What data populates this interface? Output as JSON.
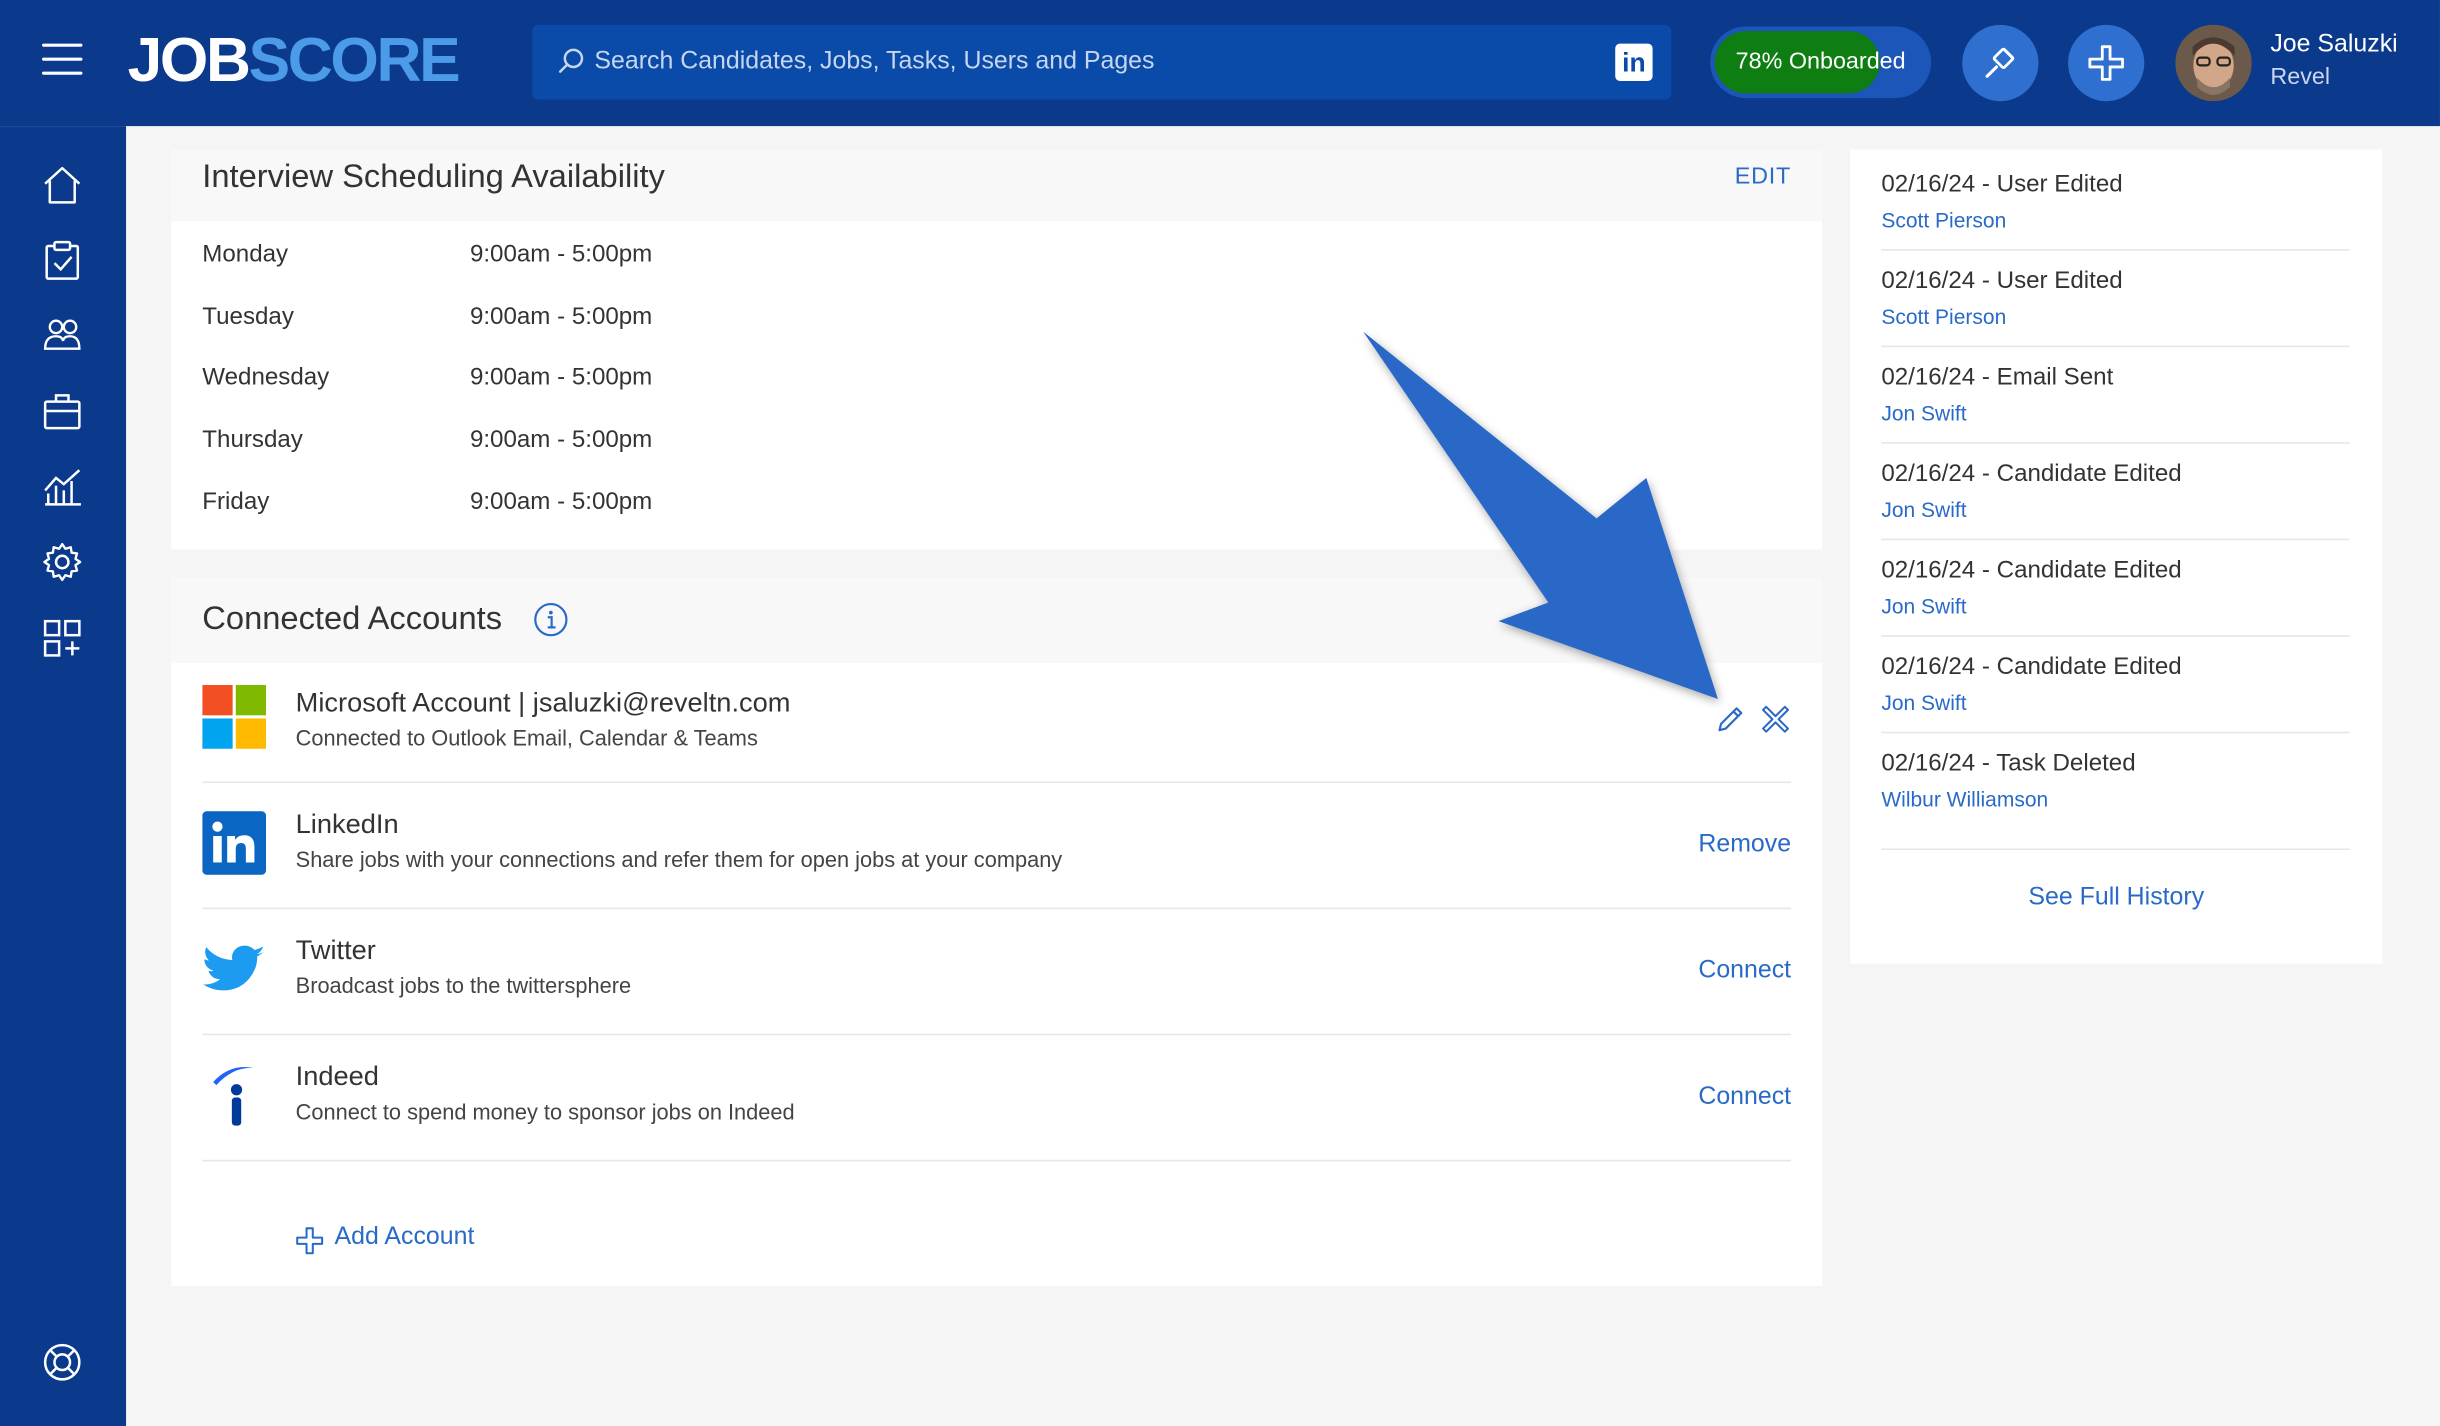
{
  "brand": {
    "logo_part1": "JOB",
    "logo_part2": "SCORE"
  },
  "search": {
    "placeholder": "Search Candidates, Jobs, Tasks, Users and Pages"
  },
  "onboarding": {
    "label": "78% Onboarded",
    "progress_percent": 78
  },
  "user": {
    "name": "Joe Saluzki",
    "org": "Revel"
  },
  "interview": {
    "title": "Interview Scheduling Availability",
    "edit_label": "EDIT",
    "rows": [
      {
        "day": "Monday",
        "time": "9:00am - 5:00pm"
      },
      {
        "day": "Tuesday",
        "time": "9:00am - 5:00pm"
      },
      {
        "day": "Wednesday",
        "time": "9:00am - 5:00pm"
      },
      {
        "day": "Thursday",
        "time": "9:00am - 5:00pm"
      },
      {
        "day": "Friday",
        "time": "9:00am - 5:00pm"
      }
    ]
  },
  "connected": {
    "title": "Connected Accounts",
    "accounts": [
      {
        "name": "Microsoft Account | jsaluzki@reveltn.com",
        "desc": "Connected to Outlook Email, Calendar & Teams",
        "action": ""
      },
      {
        "name": "LinkedIn",
        "desc": "Share jobs with your connections and refer them for open jobs at your company",
        "action": "Remove"
      },
      {
        "name": "Twitter",
        "desc": "Broadcast jobs to the twittersphere",
        "action": "Connect"
      },
      {
        "name": "Indeed",
        "desc": "Connect to spend money to sponsor jobs on Indeed",
        "action": "Connect"
      }
    ],
    "add_label": "Add Account"
  },
  "history": {
    "items": [
      {
        "title": "02/16/24 - User Edited",
        "user": "Scott Pierson"
      },
      {
        "title": "02/16/24 - User Edited",
        "user": "Scott Pierson"
      },
      {
        "title": "02/16/24 - Email Sent",
        "user": "Jon Swift"
      },
      {
        "title": "02/16/24 - Candidate Edited",
        "user": "Jon Swift"
      },
      {
        "title": "02/16/24 - Candidate Edited",
        "user": "Jon Swift"
      },
      {
        "title": "02/16/24 - Candidate Edited",
        "user": "Jon Swift"
      },
      {
        "title": "02/16/24 - Task Deleted",
        "user": "Wilbur Williamson"
      }
    ],
    "see_full_label": "See Full History"
  },
  "colors": {
    "navy": "#0b3a8c",
    "link": "#2a6ac7",
    "onboard_green": "#0e7d12",
    "arrow": "#2b68c8"
  }
}
